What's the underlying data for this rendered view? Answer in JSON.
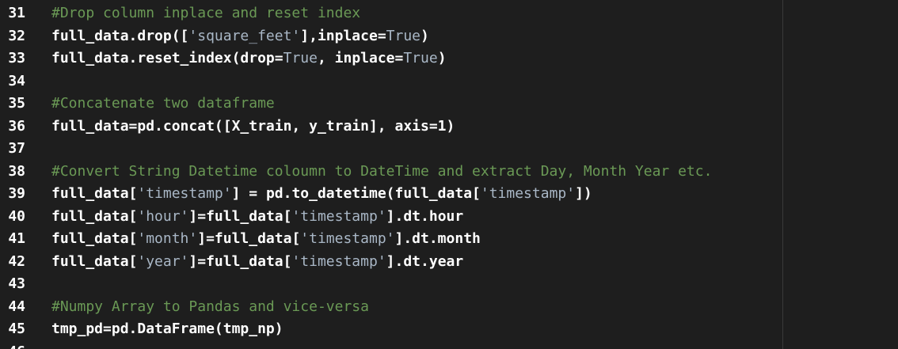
{
  "editor": {
    "lines": [
      {
        "number": "31",
        "tokens": [
          {
            "t": "comment",
            "v": "#Drop column inplace and reset index"
          }
        ]
      },
      {
        "number": "32",
        "tokens": [
          {
            "t": "plain",
            "v": "full_data.drop(["
          },
          {
            "t": "string",
            "v": "'square_feet'"
          },
          {
            "t": "plain",
            "v": "],inplace="
          },
          {
            "t": "keyword",
            "v": "True"
          },
          {
            "t": "plain",
            "v": ")"
          }
        ]
      },
      {
        "number": "33",
        "tokens": [
          {
            "t": "plain",
            "v": "full_data.reset_index(drop="
          },
          {
            "t": "keyword",
            "v": "True"
          },
          {
            "t": "plain",
            "v": ", inplace="
          },
          {
            "t": "keyword",
            "v": "True"
          },
          {
            "t": "plain",
            "v": ")"
          }
        ]
      },
      {
        "number": "34",
        "tokens": []
      },
      {
        "number": "35",
        "tokens": [
          {
            "t": "comment",
            "v": "#Concatenate two dataframe"
          }
        ]
      },
      {
        "number": "36",
        "tokens": [
          {
            "t": "plain",
            "v": "full_data=pd.concat([X_train, y_train], axis=1)"
          }
        ]
      },
      {
        "number": "37",
        "tokens": []
      },
      {
        "number": "38",
        "tokens": [
          {
            "t": "comment",
            "v": "#Convert String Datetime coloumn to DateTime and extract Day, Month Year etc."
          }
        ]
      },
      {
        "number": "39",
        "tokens": [
          {
            "t": "plain",
            "v": "full_data["
          },
          {
            "t": "string",
            "v": "'timestamp'"
          },
          {
            "t": "plain",
            "v": "] = pd.to_datetime(full_data["
          },
          {
            "t": "string",
            "v": "'timestamp'"
          },
          {
            "t": "plain",
            "v": "])"
          }
        ]
      },
      {
        "number": "40",
        "tokens": [
          {
            "t": "plain",
            "v": "full_data["
          },
          {
            "t": "string",
            "v": "'hour'"
          },
          {
            "t": "plain",
            "v": "]=full_data["
          },
          {
            "t": "string",
            "v": "'timestamp'"
          },
          {
            "t": "plain",
            "v": "].dt.hour"
          }
        ]
      },
      {
        "number": "41",
        "tokens": [
          {
            "t": "plain",
            "v": "full_data["
          },
          {
            "t": "string",
            "v": "'month'"
          },
          {
            "t": "plain",
            "v": "]=full_data["
          },
          {
            "t": "string",
            "v": "'timestamp'"
          },
          {
            "t": "plain",
            "v": "].dt.month"
          }
        ]
      },
      {
        "number": "42",
        "tokens": [
          {
            "t": "plain",
            "v": "full_data["
          },
          {
            "t": "string",
            "v": "'year'"
          },
          {
            "t": "plain",
            "v": "]=full_data["
          },
          {
            "t": "string",
            "v": "'timestamp'"
          },
          {
            "t": "plain",
            "v": "].dt.year"
          }
        ]
      },
      {
        "number": "43",
        "tokens": []
      },
      {
        "number": "44",
        "tokens": [
          {
            "t": "comment",
            "v": "#Numpy Array to Pandas and vice-versa"
          }
        ]
      },
      {
        "number": "45",
        "tokens": [
          {
            "t": "plain",
            "v": "tmp_pd=pd.DataFrame(tmp_np)"
          }
        ]
      },
      {
        "number": "46",
        "tokens": []
      }
    ]
  },
  "colors": {
    "background": "#1e1e1e",
    "comment": "#6a9955",
    "string": "#a9b7c6",
    "plain": "#ffffff"
  }
}
